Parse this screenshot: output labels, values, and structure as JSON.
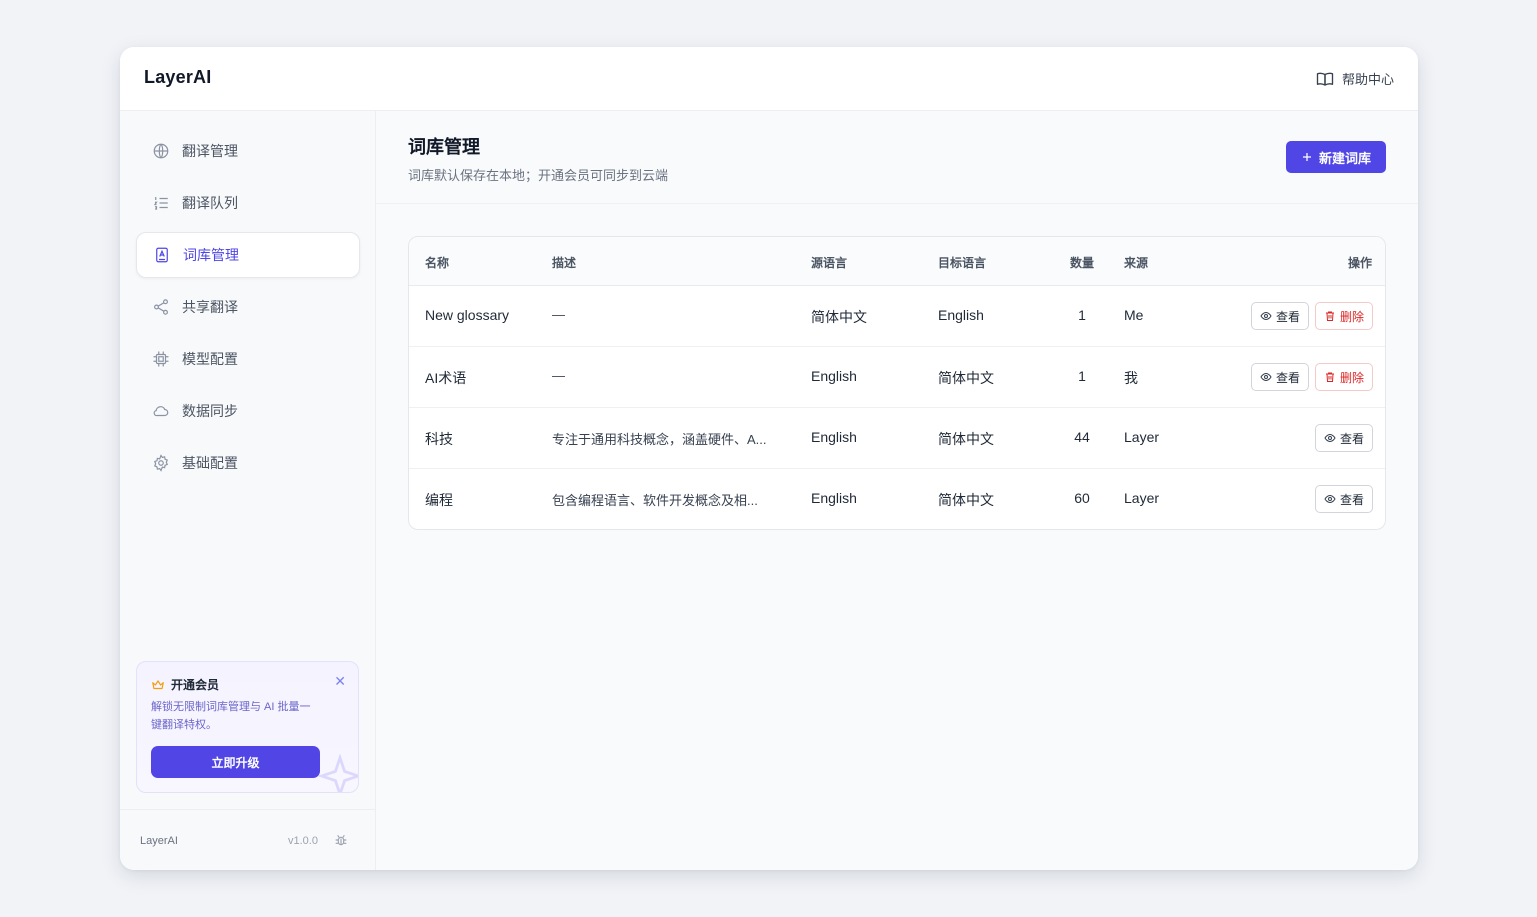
{
  "app": {
    "brand": "LayerAI",
    "help_label": "帮助中心"
  },
  "sidebar": {
    "items": [
      {
        "label": "翻译管理",
        "icon": "globe-icon"
      },
      {
        "label": "翻译队列",
        "icon": "list-icon"
      },
      {
        "label": "词库管理",
        "icon": "glossary-icon",
        "active": true
      },
      {
        "label": "共享翻译",
        "icon": "share-icon"
      },
      {
        "label": "模型配置",
        "icon": "chip-icon"
      },
      {
        "label": "数据同步",
        "icon": "cloud-icon"
      },
      {
        "label": "基础配置",
        "icon": "gear-icon"
      }
    ],
    "promo": {
      "title": "开通会员",
      "text": "解锁无限制词库管理与 AI 批量一键翻译特权。",
      "button": "立即升级"
    },
    "footer": {
      "name": "LayerAI",
      "version": "v1.0.0"
    }
  },
  "page": {
    "title": "词库管理",
    "subtitle": "词库默认保存在本地；开通会员可同步到云端",
    "new_button": "新建词库"
  },
  "table": {
    "headers": {
      "name": "名称",
      "desc": "描述",
      "source": "源语言",
      "target": "目标语言",
      "count": "数量",
      "origin": "来源",
      "actions": "操作"
    },
    "rows": [
      {
        "name": "New glossary",
        "desc": "—",
        "source": "简体中文",
        "target": "English",
        "count": "1",
        "origin": "Me",
        "view": "查看",
        "delete": "删除"
      },
      {
        "name": "AI术语",
        "desc": "—",
        "source": "English",
        "target": "简体中文",
        "count": "1",
        "origin": "我",
        "view": "查看",
        "delete": "删除"
      },
      {
        "name": "科技",
        "desc": "专注于通用科技概念，涵盖硬件、A...",
        "source": "English",
        "target": "简体中文",
        "count": "44",
        "origin": "Layer",
        "view": "查看"
      },
      {
        "name": "编程",
        "desc": "包含编程语言、软件开发概念及相...",
        "source": "English",
        "target": "简体中文",
        "count": "60",
        "origin": "Layer",
        "view": "查看"
      }
    ]
  },
  "colors": {
    "accent": "#4f46e5",
    "danger": "#dc2626",
    "promo_bg": "#f4f3ff"
  }
}
